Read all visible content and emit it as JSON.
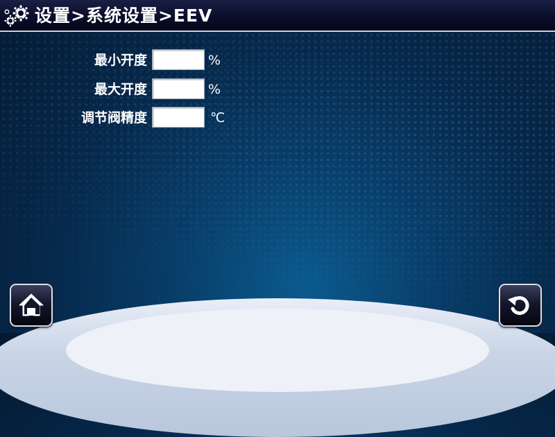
{
  "header": {
    "title": "设置>系统设置>EEV",
    "icon": "gears-icon"
  },
  "form": {
    "rows": [
      {
        "label": "最小开度",
        "value": "",
        "unit": "%"
      },
      {
        "label": "最大开度",
        "value": "",
        "unit": "%"
      },
      {
        "label": "调节阀精度",
        "value": "",
        "unit": "℃"
      }
    ]
  },
  "footer": {
    "home_icon": "home-icon",
    "back_icon": "back-arrow-icon"
  },
  "colors": {
    "header_bg": "#0a0e2a",
    "background": "#06284a",
    "field_bg": "#ffffff",
    "text": "#ffffff"
  }
}
